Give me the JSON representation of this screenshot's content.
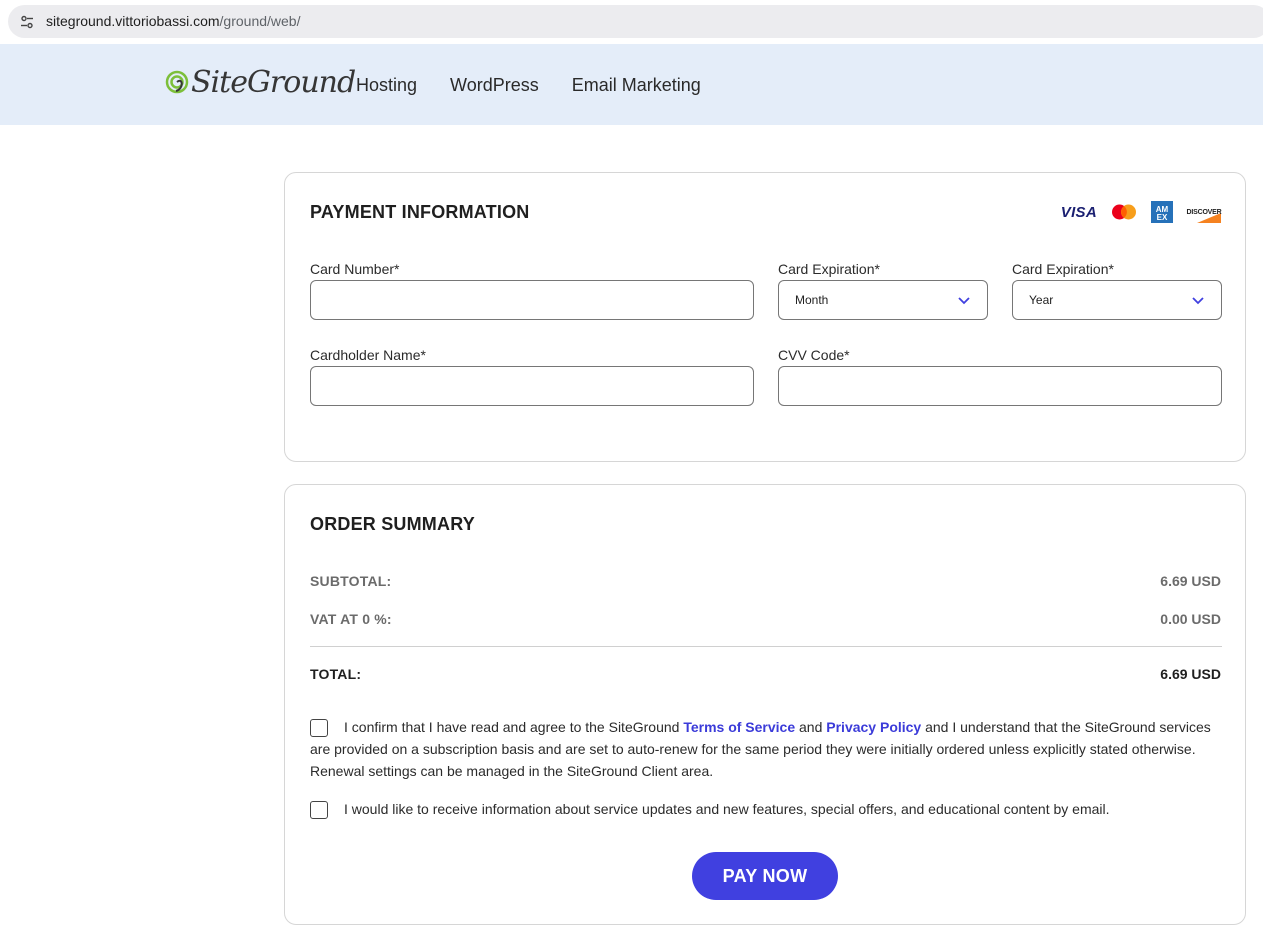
{
  "browser": {
    "url_host": "siteground.vittoriobassi.com",
    "url_path": "/ground/web/"
  },
  "header": {
    "logo_text": "SiteGround",
    "nav": [
      "Hosting",
      "WordPress",
      "Email Marketing"
    ]
  },
  "payment": {
    "title": "PAYMENT INFORMATION",
    "card_brands": {
      "visa": "VISA",
      "amex_top": "AM",
      "amex_bottom": "EX",
      "discover": "DISCOVER"
    },
    "card_number_label": "Card Number*",
    "card_number_value": "",
    "exp_month_label": "Card Expiration*",
    "exp_month_value": "Month",
    "exp_year_label": "Card Expiration*",
    "exp_year_value": "Year",
    "cardholder_label": "Cardholder Name*",
    "cardholder_value": "",
    "cvv_label": "CVV Code*",
    "cvv_value": ""
  },
  "order": {
    "title": "ORDER SUMMARY",
    "subtotal_label": "SUBTOTAL:",
    "subtotal_value": "6.69 USD",
    "vat_label": "VAT AT 0 %:",
    "vat_value": "0.00 USD",
    "total_label": "TOTAL:",
    "total_value": "6.69 USD",
    "terms_text_1": "I confirm that I have read and agree to the SiteGround ",
    "terms_link": "Terms of Service",
    "terms_text_2": " and ",
    "privacy_link": "Privacy Policy",
    "terms_text_3": " and I understand that the SiteGround services are provided on a subscription basis and are set to auto-renew for the same period they were initially ordered unless explicitly stated otherwise. Renewal settings can be managed in the SiteGround Client area.",
    "terms_checked": false,
    "newsletter_text": "I would like to receive information about service updates and new features, special offers, and educational content by email.",
    "newsletter_checked": false,
    "pay_button": "PAY NOW"
  },
  "colors": {
    "header_bg": "#e4edf9",
    "accent": "#4040e0",
    "link": "#3b3bd9"
  }
}
